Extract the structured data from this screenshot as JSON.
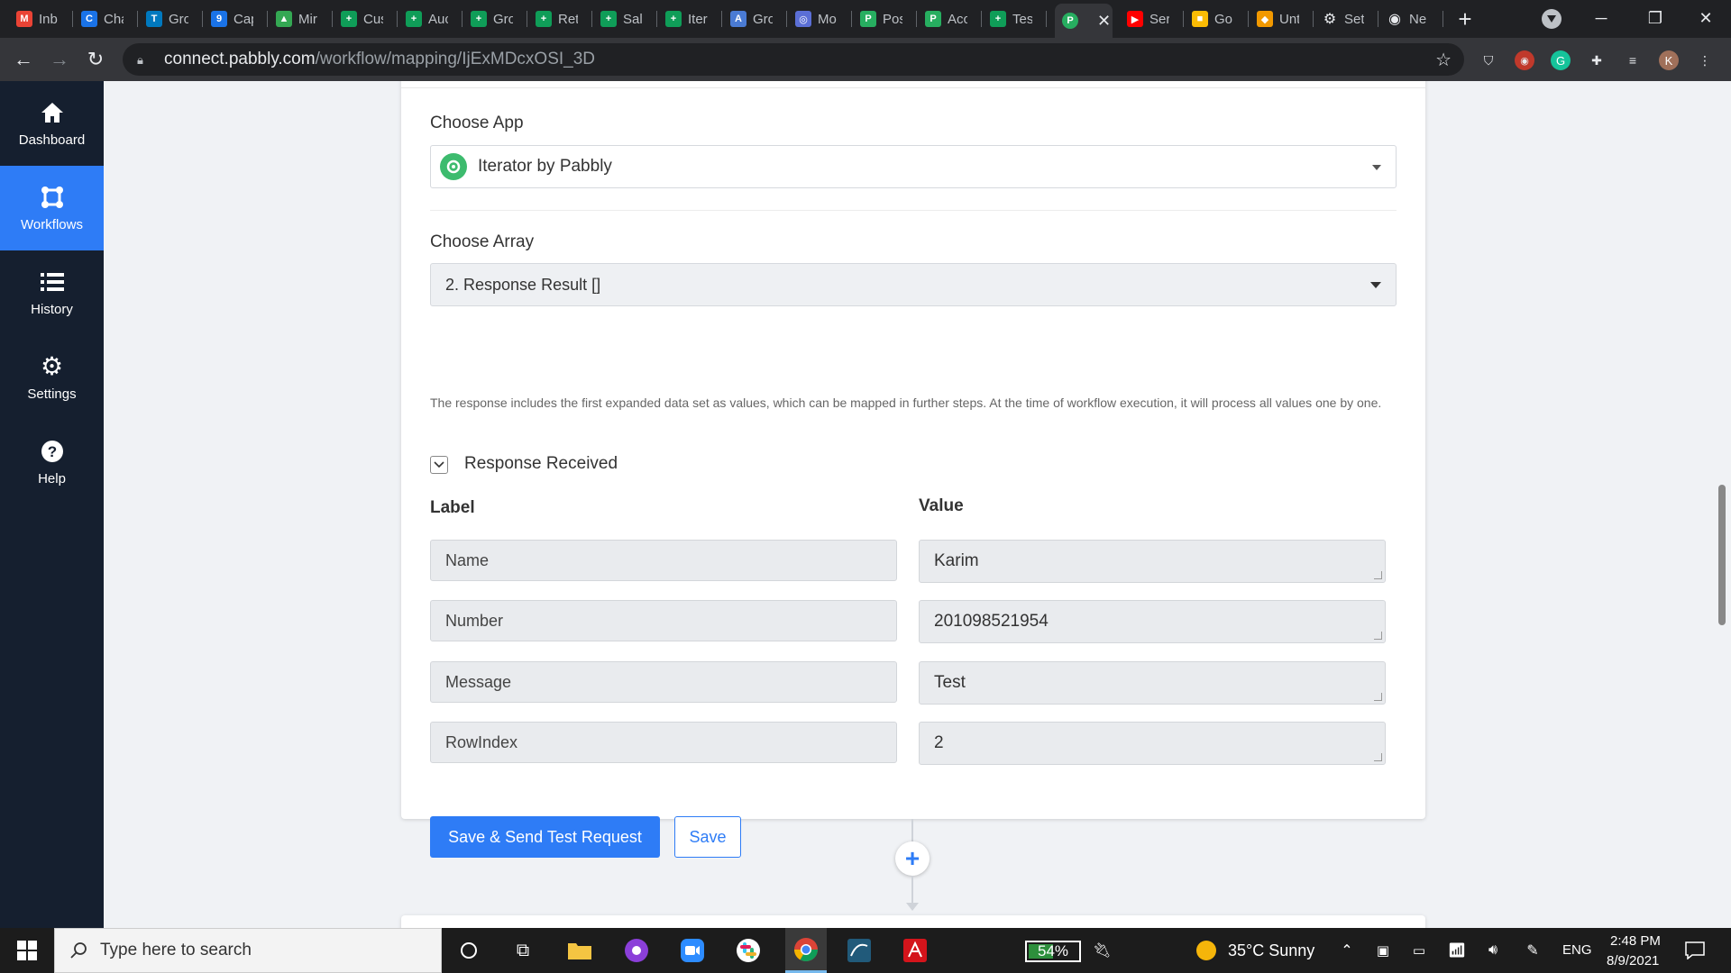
{
  "browser": {
    "tabs": [
      {
        "name": "Inb",
        "icon": "gmail-icon",
        "color": "#ea4335",
        "glyph": "M"
      },
      {
        "name": "Cha",
        "icon": "chat-icon",
        "color": "#1a73e8",
        "glyph": "C"
      },
      {
        "name": "Gro",
        "icon": "trello-icon",
        "color": "#0079bf",
        "glyph": "T"
      },
      {
        "name": "Cap",
        "icon": "calendar-icon",
        "color": "#1a73e8",
        "glyph": "9"
      },
      {
        "name": "Mir",
        "icon": "drive-icon",
        "color": "#34a853",
        "glyph": "▲"
      },
      {
        "name": "Cus",
        "icon": "sheets-icon",
        "color": "#0f9d58",
        "glyph": "+"
      },
      {
        "name": "Auc",
        "icon": "sheets-icon",
        "color": "#0f9d58",
        "glyph": "+"
      },
      {
        "name": "Gro",
        "icon": "sheets-icon",
        "color": "#0f9d58",
        "glyph": "+"
      },
      {
        "name": "Ret",
        "icon": "sheets-icon",
        "color": "#0f9d58",
        "glyph": "+"
      },
      {
        "name": "Sal",
        "icon": "sheets-icon",
        "color": "#0f9d58",
        "glyph": "+"
      },
      {
        "name": "Iter",
        "icon": "sheets-icon",
        "color": "#0f9d58",
        "glyph": "+"
      },
      {
        "name": "Gro",
        "icon": "translate-icon",
        "color": "#4a7bd4",
        "glyph": "A"
      },
      {
        "name": "Mo",
        "icon": "circle-logo-icon",
        "color": "#5b6fd6",
        "glyph": "◎"
      },
      {
        "name": "Pos",
        "icon": "pabbly-icon",
        "color": "#27ae60",
        "glyph": "P"
      },
      {
        "name": "Acc",
        "icon": "pabbly-icon",
        "color": "#27ae60",
        "glyph": "P"
      },
      {
        "name": "Tes",
        "icon": "sheets-icon",
        "color": "#0f9d58",
        "glyph": "+"
      }
    ],
    "active_tab": {
      "icon": "pabbly-icon",
      "color": "#27ae60",
      "glyph": "P"
    },
    "tabs_right": [
      {
        "name": "Ser",
        "icon": "youtube-icon",
        "color": "#ff0000",
        "glyph": "▶"
      },
      {
        "name": "Go",
        "icon": "keep-icon",
        "color": "#fbbc04",
        "glyph": "■"
      },
      {
        "name": "Unt",
        "icon": "app-icon",
        "color": "#f29900",
        "glyph": "◆"
      },
      {
        "name": "Set",
        "icon": "gear-icon",
        "color": "transparent",
        "glyph": "⚙"
      },
      {
        "name": "Ne",
        "icon": "chrome-icon",
        "color": "transparent",
        "glyph": "◉"
      }
    ],
    "url_host": "connect.pabbly.com",
    "url_path": "/workflow/mapping/IjExMDcxOSI_3D",
    "profile_initial": "K"
  },
  "sidebar": {
    "items": [
      {
        "label": "Dashboard",
        "icon": "home-icon"
      },
      {
        "label": "Workflows",
        "icon": "workflow-icon"
      },
      {
        "label": "History",
        "icon": "list-icon"
      },
      {
        "label": "Settings",
        "icon": "gear-icon"
      },
      {
        "label": "Help",
        "icon": "help-icon"
      }
    ],
    "active_index": 1
  },
  "form": {
    "choose_app_label": "Choose App",
    "app_value": "Iterator by Pabbly",
    "choose_array_label": "Choose Array",
    "array_value": "2. Response Result []",
    "help_text": "The response includes the first expanded data set as values, which can be mapped in further steps. At the time of workflow execution, it will process all values one by one.",
    "response_received_label": "Response Received",
    "label_header": "Label",
    "value_header": "Value",
    "rows": [
      {
        "label": "Name",
        "value": "Karim"
      },
      {
        "label": "Number",
        "value": "201098521954"
      },
      {
        "label": "Message",
        "value": "Test"
      },
      {
        "label": "RowIndex",
        "value": "2"
      }
    ],
    "save_send_label": "Save & Send Test Request",
    "save_label": "Save",
    "add_step_glyph": "+"
  },
  "taskbar": {
    "search_placeholder": "Type here to search",
    "battery_percent": "54%",
    "battery_level": 0.54,
    "weather": "35°C  Sunny",
    "language": "ENG",
    "time": "2:48 PM",
    "date": "8/9/2021"
  },
  "colors": {
    "accent": "#2e7cf6",
    "sidebar_bg": "#151f2f"
  }
}
